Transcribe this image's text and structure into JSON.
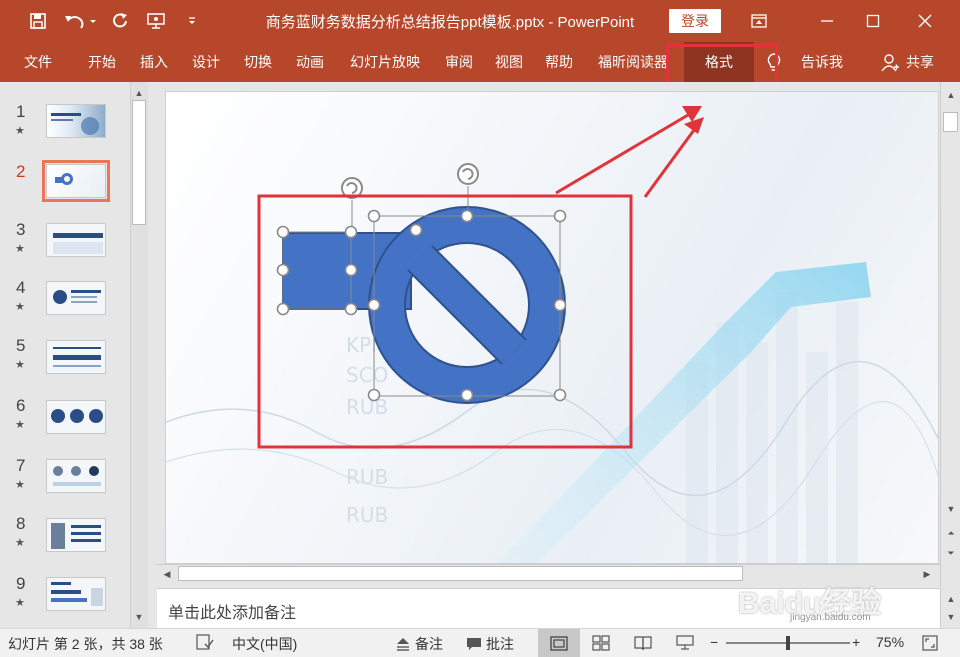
{
  "window": {
    "title": "商务蓝财务数据分析总结报告ppt模板.pptx  -  PowerPoint",
    "login_label": "登录",
    "accent_color": "#b7472a"
  },
  "quick_access": [
    "save-icon",
    "undo-icon",
    "redo-icon",
    "present-icon",
    "customize-icon"
  ],
  "ribbon": {
    "tabs": [
      "文件",
      "开始",
      "插入",
      "设计",
      "切换",
      "动画",
      "幻灯片放映",
      "审阅",
      "视图",
      "帮助",
      "福昕阅读器",
      "格式"
    ],
    "active_tab": "格式",
    "tell_me": "告诉我",
    "share": "共享"
  },
  "thumbnails": {
    "numbers": [
      "1",
      "2",
      "3",
      "4",
      "5",
      "6",
      "7",
      "8",
      "9"
    ],
    "selected": "2",
    "star": "★"
  },
  "notes": {
    "placeholder": "单击此处添加备注"
  },
  "status": {
    "slide_info": "幻灯片 第 2 张，共 38 张",
    "language": "中文(中国)",
    "notes_label": "备注",
    "comments_label": "批注",
    "zoom_minus": "−",
    "zoom_plus": "+",
    "zoom": "75%",
    "zoom_fraction": 0.5
  },
  "watermark": {
    "text": "Baidu经验",
    "sub": "jingyan.baidu.com"
  },
  "annotation_color": "#e0333a",
  "shape_color": "#4472c4"
}
